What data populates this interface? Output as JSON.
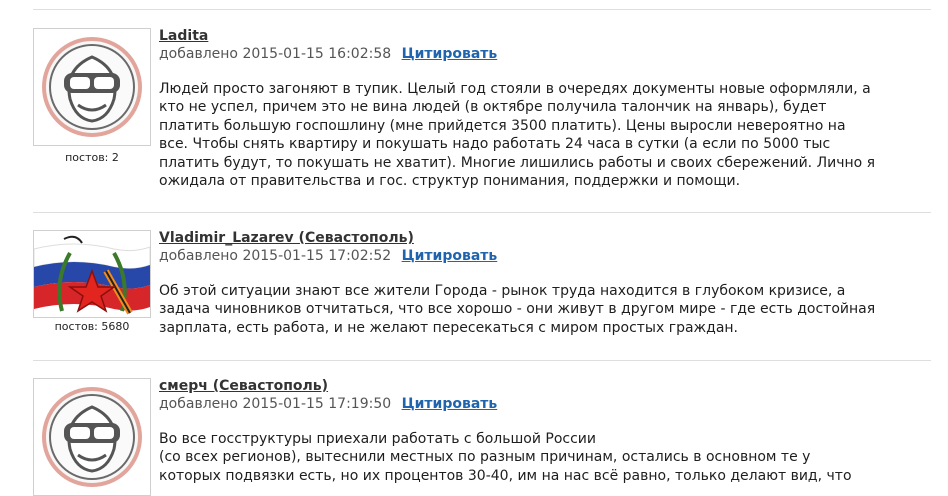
{
  "posts": [
    {
      "author": "Ladita",
      "added_label": "добавлено",
      "timestamp": "2015-01-15 16:02:58",
      "quote_label": "Цитировать",
      "posts_count": "постов: 2",
      "avatar_icon": "goggles-face-icon",
      "text": "Людей просто загоняют в тупик. Целый год стояли в очередях документы новые оформляли, а\nкто не успел, причем это не вина людей (в октябре получила талончик на январь), будет\nплатить большую госпошлину (мне прийдется 3500 платить). Цены выросли невероятно на\nвсе. Чтобы снять квартиру и покушать надо работать 24 часа в сутки (а если по 5000 тыс\nплатить будут, то покушать не хватит). Многие лишились работы и своих сбережений. Лично я\nожидала от правительства и гос. структур понимания, поддержки и помощи."
    },
    {
      "author": "Vladimir_Lazarev (Севастополь)",
      "added_label": "добавлено",
      "timestamp": "2015-01-15 17:02:52",
      "quote_label": "Цитировать",
      "posts_count": "постов: 5680",
      "avatar_icon": "flag-star-emblem-icon",
      "text": "Об этой ситуации знают все жители Города - рынок труда находится в глубоком кризисе, а\nзадача чиновников отчитаться, что все хорошо - они живут в другом мире - где есть достойная\nзарплата, есть работа, и не желают пересекаться с миром простых граждан."
    },
    {
      "author": "смерч (Севастополь)",
      "added_label": "добавлено",
      "timestamp": "2015-01-15 17:19:50",
      "quote_label": "Цитировать",
      "avatar_icon": "goggles-face-icon",
      "text": "Во все госструктуры приехали работать с большой России\n(со всех регионов), вытеснили местных по разным причинам, остались в основном те у\nкоторых подвязки есть, но их процентов 30-40, им на нас всё равно, только делают вид, что"
    }
  ]
}
